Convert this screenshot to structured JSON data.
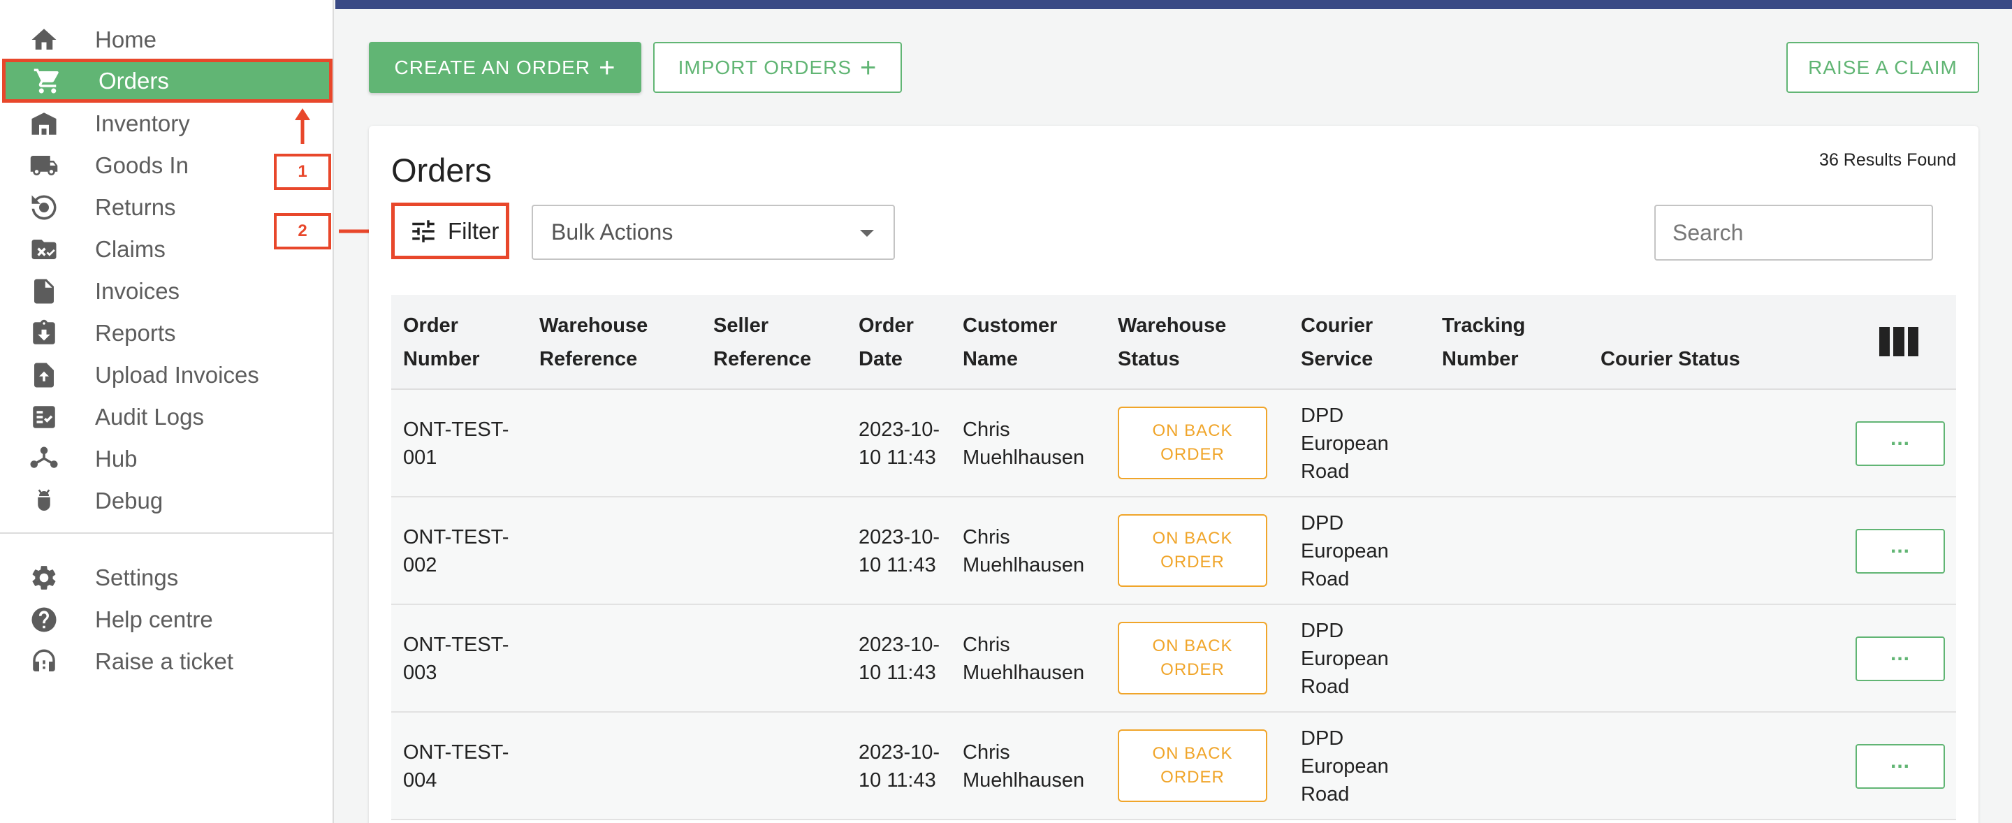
{
  "sidebar": {
    "items": [
      {
        "label": "Home",
        "icon": "home-icon"
      },
      {
        "label": "Orders",
        "icon": "cart-icon",
        "active": true
      },
      {
        "label": "Inventory",
        "icon": "warehouse-icon"
      },
      {
        "label": "Goods In",
        "icon": "truck-icon"
      },
      {
        "label": "Returns",
        "icon": "returns-icon"
      },
      {
        "label": "Claims",
        "icon": "claims-icon"
      },
      {
        "label": "Invoices",
        "icon": "document-icon"
      },
      {
        "label": "Reports",
        "icon": "report-download-icon"
      },
      {
        "label": "Upload Invoices",
        "icon": "upload-icon"
      },
      {
        "label": "Audit Logs",
        "icon": "audit-icon"
      },
      {
        "label": "Hub",
        "icon": "hub-icon"
      },
      {
        "label": "Debug",
        "icon": "bug-icon"
      }
    ],
    "footer_items": [
      {
        "label": "Settings",
        "icon": "gear-icon"
      },
      {
        "label": "Help centre",
        "icon": "help-icon"
      },
      {
        "label": "Raise a ticket",
        "icon": "support-icon"
      }
    ]
  },
  "annotations": {
    "step1": "1",
    "step2": "2",
    "color": "#e8472b"
  },
  "toolbar": {
    "create_order": "CREATE AN ORDER",
    "import_orders": "IMPORT ORDERS",
    "raise_claim": "RAISE A CLAIM",
    "plus": "+"
  },
  "main": {
    "title": "Orders",
    "results": "36 Results Found",
    "filter_label": "Filter",
    "bulk_actions": "Bulk Actions",
    "search_placeholder": "Search"
  },
  "table": {
    "columns": [
      [
        "Order",
        "Number"
      ],
      [
        "Warehouse",
        "Reference"
      ],
      [
        "Seller",
        "Reference"
      ],
      [
        "Order",
        "Date"
      ],
      [
        "Customer",
        "Name"
      ],
      [
        "Warehouse",
        "Status"
      ],
      [
        "Courier",
        "Service"
      ],
      [
        "Tracking",
        "Number"
      ],
      [
        "Courier Status"
      ]
    ],
    "rows": [
      {
        "order": [
          "ONT-TEST-",
          "001"
        ],
        "date": [
          "2023-10-",
          "10 11:43"
        ],
        "customer": [
          "Chris",
          "Muehlhausen"
        ],
        "status": [
          "ON BACK",
          "ORDER"
        ],
        "courier": [
          "DPD",
          "European",
          "Road"
        ],
        "more": "..."
      },
      {
        "order": [
          "ONT-TEST-",
          "002"
        ],
        "date": [
          "2023-10-",
          "10 11:43"
        ],
        "customer": [
          "Chris",
          "Muehlhausen"
        ],
        "status": [
          "ON BACK",
          "ORDER"
        ],
        "courier": [
          "DPD",
          "European",
          "Road"
        ],
        "more": "..."
      },
      {
        "order": [
          "ONT-TEST-",
          "003"
        ],
        "date": [
          "2023-10-",
          "10 11:43"
        ],
        "customer": [
          "Chris",
          "Muehlhausen"
        ],
        "status": [
          "ON BACK",
          "ORDER"
        ],
        "courier": [
          "DPD",
          "European",
          "Road"
        ],
        "more": "..."
      },
      {
        "order": [
          "ONT-TEST-",
          "004"
        ],
        "date": [
          "2023-10-",
          "10 11:43"
        ],
        "customer": [
          "Chris",
          "Muehlhausen"
        ],
        "status": [
          "ON BACK",
          "ORDER"
        ],
        "courier": [
          "DPD",
          "European",
          "Road"
        ],
        "more": "..."
      }
    ]
  },
  "colors": {
    "accent": "#61b574",
    "topbar": "#3a4a85",
    "warning": "#f0a52a",
    "annotation": "#e8472b"
  }
}
